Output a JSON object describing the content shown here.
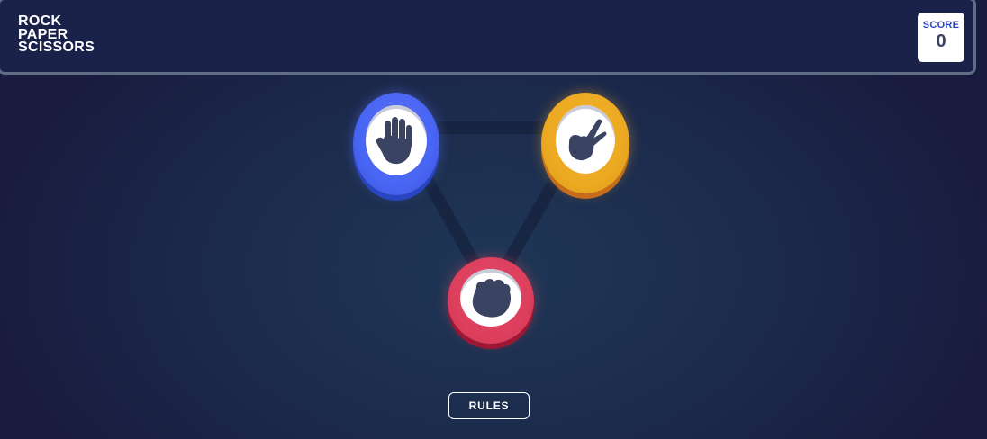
{
  "header": {
    "logo_lines": [
      "ROCK",
      "PAPER",
      "SCISSORS"
    ]
  },
  "score": {
    "label": "SCORE",
    "value": "0"
  },
  "choices": [
    {
      "name": "paper",
      "icon": "paper-hand-icon",
      "color": "#4865f4"
    },
    {
      "name": "scissors",
      "icon": "scissors-hand-icon",
      "color": "#eca922"
    },
    {
      "name": "rock",
      "icon": "rock-fist-icon",
      "color": "#dd405d"
    }
  ],
  "icon_color": "#3b4363",
  "rules_label": "RULES"
}
